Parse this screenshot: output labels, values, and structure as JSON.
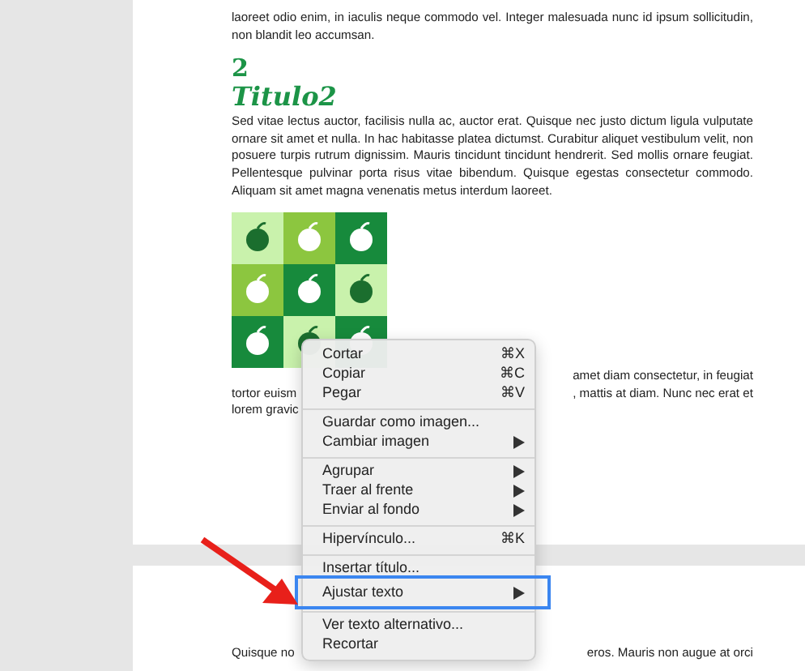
{
  "document": {
    "pages": [
      {
        "blocks": [
          {
            "kind": "paragraph",
            "text": "laoreet odio enim, in iaculis neque commodo vel. Integer malesuada nunc id ipsum sollicitudin, non blandit leo accumsan."
          },
          {
            "kind": "heading_number",
            "text": "2"
          },
          {
            "kind": "heading",
            "text": "Titulo2"
          },
          {
            "kind": "paragraph",
            "text": "Sed vitae lectus auctor, facilisis nulla ac, auctor erat. Quisque nec justo dictum ligula vulputate ornare sit amet et nulla. In hac habitasse platea dictumst. Curabitur aliquet vestibulum velit, non posuere turpis rutrum dignissim. Mauris tincidunt tincidunt hendrerit. Sed mollis ornare feugiat. Pellentesque pulvinar porta risus vitae bibendum. Quisque egestas consectetur commodo. Aliquam sit amet magna venenatis metus interdum laoreet."
          },
          {
            "kind": "image"
          },
          {
            "kind": "covered_lines",
            "lines": [
              {
                "right": "amet diam consectetur, in feugiat"
              },
              {
                "left": "tortor euism",
                "right": ", mattis at diam. Nunc nec erat et"
              },
              {
                "left": "lorem gravic"
              }
            ]
          }
        ]
      },
      {
        "blocks": [
          {
            "kind": "covered_lines",
            "lines": [
              {
                "left": "Quisque no",
                "right": "eros. Mauris non augue at orci"
              }
            ]
          }
        ]
      }
    ]
  },
  "context_menu": {
    "items": [
      {
        "kind": "item",
        "label": "Cortar",
        "shortcut": "⌘X",
        "selected": false
      },
      {
        "kind": "item",
        "label": "Copiar",
        "shortcut": "⌘C",
        "selected": false
      },
      {
        "kind": "item",
        "label": "Pegar",
        "shortcut": "⌘V",
        "selected": false
      },
      {
        "kind": "separator"
      },
      {
        "kind": "item",
        "label": "Guardar como imagen...",
        "selected": false
      },
      {
        "kind": "submenu",
        "label": "Cambiar imagen",
        "selected": false
      },
      {
        "kind": "separator"
      },
      {
        "kind": "submenu",
        "label": "Agrupar",
        "selected": false
      },
      {
        "kind": "submenu",
        "label": "Traer al frente",
        "selected": false
      },
      {
        "kind": "submenu",
        "label": "Enviar al fondo",
        "selected": false
      },
      {
        "kind": "separator"
      },
      {
        "kind": "item",
        "label": "Hipervínculo...",
        "shortcut": "⌘K",
        "selected": false
      },
      {
        "kind": "separator"
      },
      {
        "kind": "item",
        "label": "Insertar título...",
        "selected": false
      },
      {
        "kind": "submenu",
        "label": "Ajustar texto",
        "selected": true
      },
      {
        "kind": "separator"
      },
      {
        "kind": "item",
        "label": "Ver texto alternativo...",
        "selected": false
      },
      {
        "kind": "item",
        "label": "Recortar",
        "selected": false
      }
    ]
  }
}
